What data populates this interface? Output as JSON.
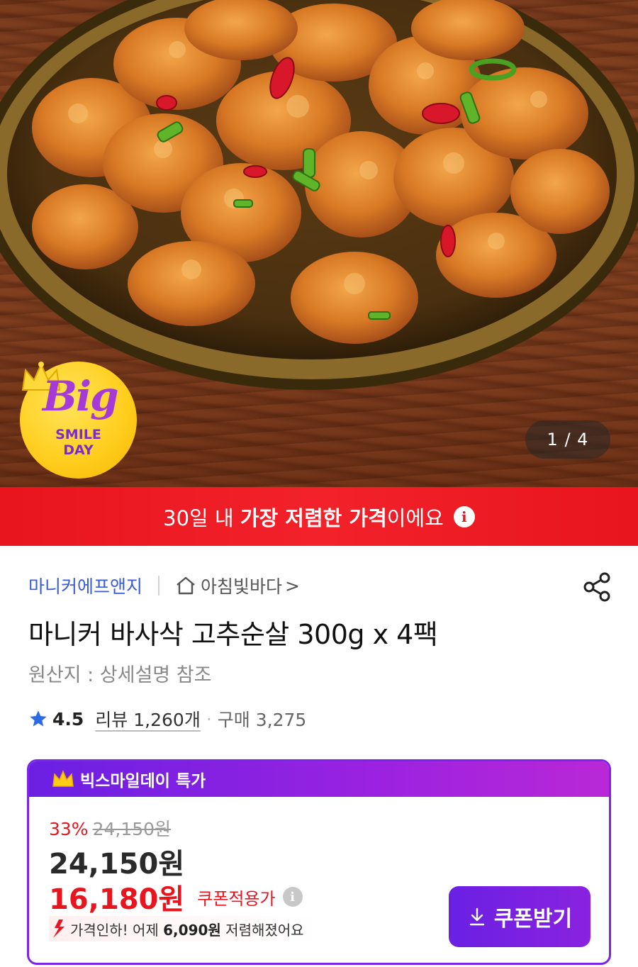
{
  "hero": {
    "page_counter": "1 / 4",
    "badge": {
      "big": "Big",
      "line1": "SMILE",
      "line2": "DAY"
    }
  },
  "banner": {
    "prefix": "30일 내 ",
    "highlight": "가장 저렴한 가격",
    "suffix": "이에요"
  },
  "seller": {
    "brand": "마니커에프앤지",
    "shop": "아침빛바다",
    "shop_chevron": ">"
  },
  "product": {
    "title": "마니커 바사삭 고추순살 300g x 4팩",
    "origin": "원산지 : 상세설명 참조",
    "rating": "4.5",
    "reviews": "리뷰 1,260개",
    "purchases": "구매 3,275"
  },
  "price_card": {
    "header": "빅스마일데이 특가",
    "discount_rate": "33%",
    "original_price": "24,150원",
    "sale_price": "24,150원",
    "coupon_price": "16,180원",
    "coupon_label": "쿠폰적용가",
    "drop_prefix": "가격인하! 어제 ",
    "drop_amount": "6,090원",
    "drop_suffix": " 저렴해졌어요",
    "coupon_button": "쿠폰받기"
  },
  "colors": {
    "accent_purple": "#7a25e8",
    "banner_red": "#e8141e",
    "brand_blue": "#3b5bd9"
  },
  "icons": [
    "info-icon",
    "home-icon",
    "share-icon",
    "star-icon",
    "crown-icon",
    "arrow-down-icon",
    "download-icon"
  ]
}
